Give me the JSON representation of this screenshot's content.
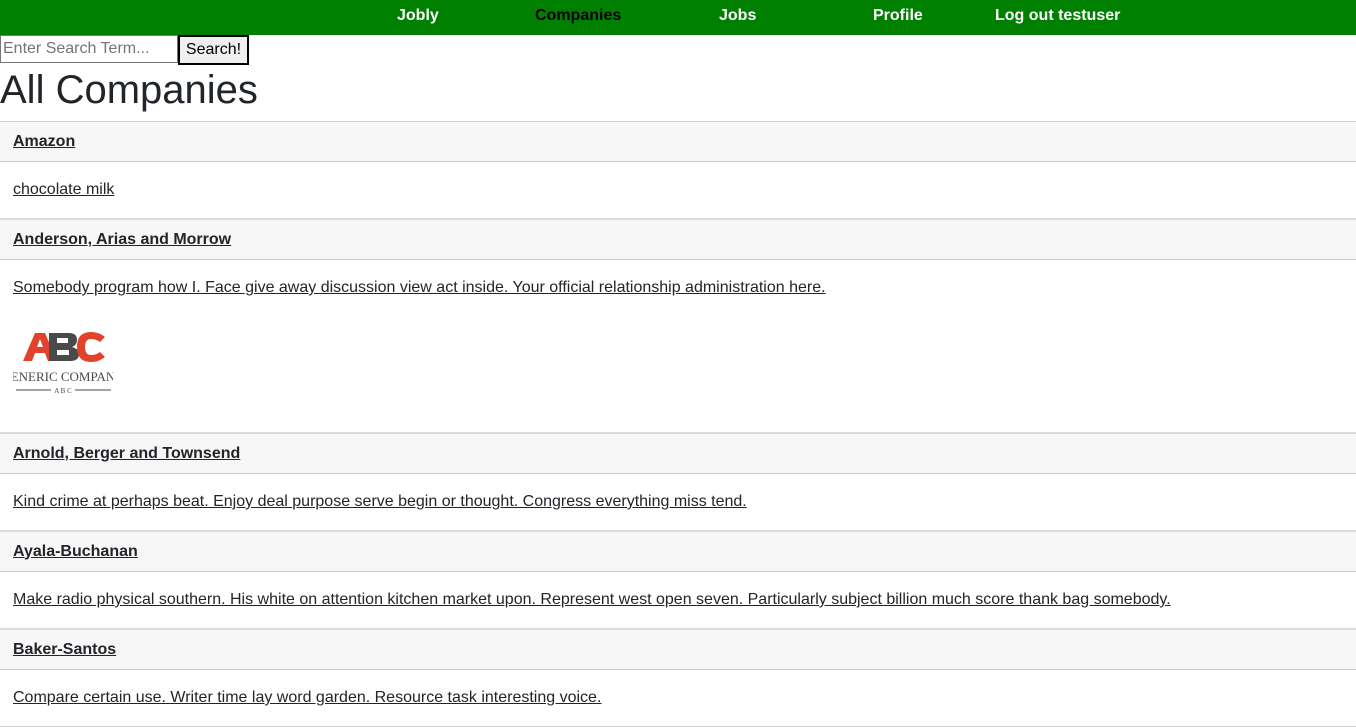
{
  "nav": {
    "brand": "Jobly",
    "companies": "Companies",
    "jobs": "Jobs",
    "profile": "Profile",
    "logout": "Log out testuser"
  },
  "search": {
    "placeholder": "Enter Search Term...",
    "value": "",
    "button_label": "Search!"
  },
  "page_title": "All Companies",
  "companies": [
    {
      "name": "Amazon",
      "description": "chocolate milk",
      "logo": null
    },
    {
      "name": "Anderson, Arias and Morrow",
      "description": "Somebody program how I. Face give away discussion view act inside. Your official relationship administration here.",
      "logo": {
        "icon": "abc-generic-company-logo",
        "mark_text": "ABC",
        "company_text": "GENERIC COMPANY",
        "sub_text": "A B C",
        "colors": {
          "accent": "#e2412b",
          "dark": "#4a4a4a"
        }
      }
    },
    {
      "name": "Arnold, Berger and Townsend",
      "description": "Kind crime at perhaps beat. Enjoy deal purpose serve begin or thought. Congress everything miss tend.",
      "logo": null
    },
    {
      "name": "Ayala-Buchanan",
      "description": "Make radio physical southern. His white on attention kitchen market upon. Represent west open seven. Particularly subject billion much score thank bag somebody.",
      "logo": null
    },
    {
      "name": "Baker-Santos",
      "description": "Compare certain use. Writer time lay word garden. Resource task interesting voice.",
      "logo": null
    }
  ],
  "colors": {
    "navbar": "#008000",
    "nav_text": "#ffffff",
    "nav_active_text": "#000000",
    "card_header_bg": "#f7f7f7",
    "text": "#212529"
  }
}
